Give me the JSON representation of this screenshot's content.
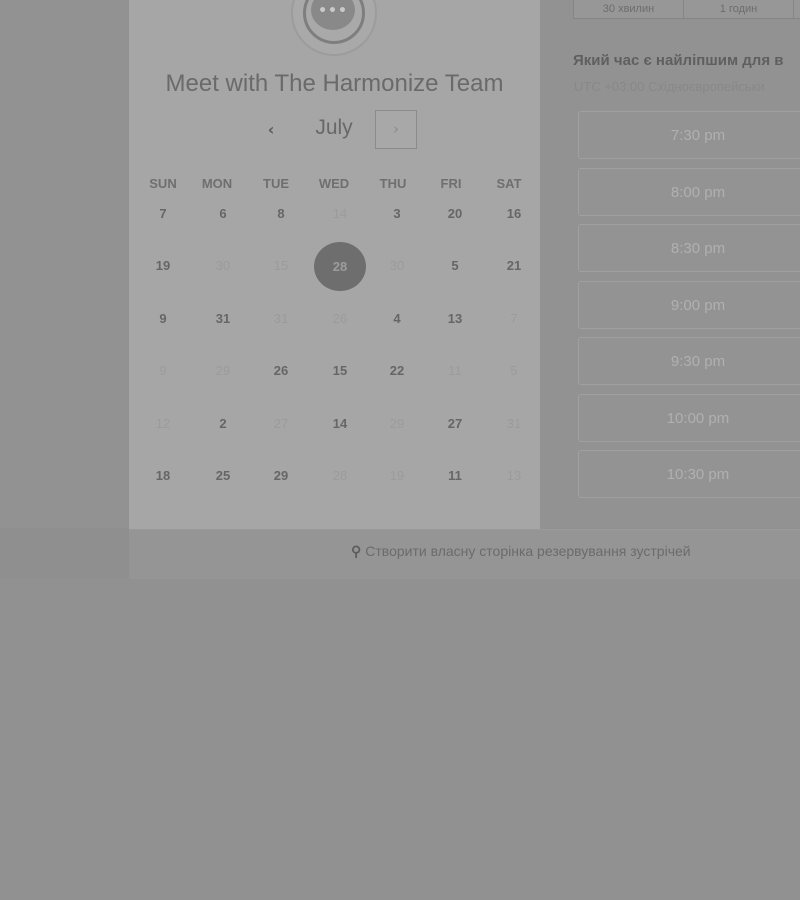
{
  "header": {
    "title": "Meet with The Harmonize Team",
    "logo_icon": "chat-bubble-icon",
    "logo_dots": "•••"
  },
  "calendar": {
    "month": "July",
    "prev_icon": "‹",
    "next_icon": "›",
    "weekdays": [
      "SUN",
      "MON",
      "TUE",
      "WED",
      "THU",
      "FRI",
      "SAT"
    ],
    "weeks": [
      [
        {
          "t": "7"
        },
        {
          "t": "6"
        },
        {
          "t": "8"
        },
        {
          "t": "14",
          "off": true
        },
        {
          "t": "3"
        },
        {
          "t": "20"
        },
        {
          "t": "16"
        }
      ],
      [
        {
          "t": "19"
        },
        {
          "t": "30",
          "off": true
        },
        {
          "t": "15",
          "off": true
        },
        {
          "t": "28",
          "sel": true
        },
        {
          "t": "30",
          "off": true
        },
        {
          "t": "5"
        },
        {
          "t": "21"
        }
      ],
      [
        {
          "t": "9"
        },
        {
          "t": "31"
        },
        {
          "t": "31",
          "off": true
        },
        {
          "t": "26",
          "off": true
        },
        {
          "t": "4"
        },
        {
          "t": "13"
        },
        {
          "t": "7",
          "off": true
        }
      ],
      [
        {
          "t": "9",
          "off": true
        },
        {
          "t": "29",
          "off": true
        },
        {
          "t": "26"
        },
        {
          "t": "15"
        },
        {
          "t": "22"
        },
        {
          "t": "11",
          "off": true
        },
        {
          "t": "5",
          "off": true
        }
      ],
      [
        {
          "t": "12",
          "off": true
        },
        {
          "t": "2"
        },
        {
          "t": "27",
          "off": true
        },
        {
          "t": "14"
        },
        {
          "t": "29",
          "off": true
        },
        {
          "t": "27"
        },
        {
          "t": "31",
          "off": true
        }
      ],
      [
        {
          "t": "18"
        },
        {
          "t": "25"
        },
        {
          "t": "29"
        },
        {
          "t": "28",
          "off": true
        },
        {
          "t": "19",
          "off": true
        },
        {
          "t": "11"
        },
        {
          "t": "13",
          "off": true
        }
      ]
    ]
  },
  "durations": [
    "30 хвилин",
    "1 годин"
  ],
  "times_panel": {
    "question": "Який час є найліпшим для в",
    "timezone": "UTC +03:00 Східноєвропейськи",
    "slots": [
      "7:30 pm",
      "8:00 pm",
      "8:30 pm",
      "9:00 pm",
      "9:30 pm",
      "10:00 pm",
      "10:30 pm"
    ]
  },
  "footer": {
    "link_icon": "hubspot-sprocket-icon",
    "link_label": "Створити власну сторінка резервування зустрічей"
  },
  "colors": {
    "overlay": "#919191",
    "card": "#a6a6a6",
    "selected_day": "#6e6e6e"
  }
}
